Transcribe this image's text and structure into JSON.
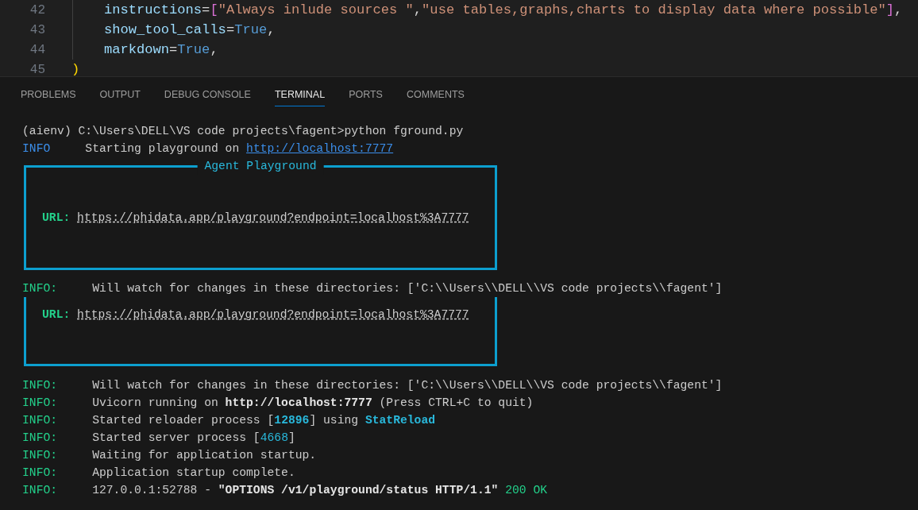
{
  "editor": {
    "lines": [
      {
        "number": "42",
        "kind": "argument",
        "tokens": [
          {
            "text": "instructions",
            "kind": "param"
          },
          {
            "text": "=",
            "kind": "op"
          },
          {
            "text": "[",
            "kind": "bracket"
          },
          {
            "text": "\"Always inlude sources \"",
            "kind": "string"
          },
          {
            "text": ",",
            "kind": "op"
          },
          {
            "text": "\"use tables,graphs,charts to display data where possible\"",
            "kind": "string"
          },
          {
            "text": "]",
            "kind": "bracket"
          },
          {
            "text": ",",
            "kind": "op"
          }
        ]
      },
      {
        "number": "43",
        "kind": "argument",
        "tokens": [
          {
            "text": "show_tool_calls",
            "kind": "param"
          },
          {
            "text": "=",
            "kind": "op"
          },
          {
            "text": "True",
            "kind": "const"
          },
          {
            "text": ",",
            "kind": "op"
          }
        ]
      },
      {
        "number": "44",
        "kind": "argument",
        "tokens": [
          {
            "text": "markdown",
            "kind": "param"
          },
          {
            "text": "=",
            "kind": "op"
          },
          {
            "text": "True",
            "kind": "const"
          },
          {
            "text": ",",
            "kind": "op"
          }
        ]
      },
      {
        "number": "45",
        "kind": "closing",
        "tokens": [
          {
            "text": ")",
            "kind": "paren"
          }
        ]
      }
    ]
  },
  "panel": {
    "tabs": [
      {
        "label": "PROBLEMS",
        "selected": false
      },
      {
        "label": "OUTPUT",
        "selected": false
      },
      {
        "label": "DEBUG CONSOLE",
        "selected": false
      },
      {
        "label": "TERMINAL",
        "selected": true
      },
      {
        "label": "PORTS",
        "selected": false
      },
      {
        "label": "COMMENTS",
        "selected": false
      }
    ]
  },
  "terminal": {
    "lines": [
      {
        "kind": "line",
        "segments": [
          {
            "text": "(aienv) C:\\Users\\DELL\\VS code projects\\fagent>python fground.py",
            "kind": "plain"
          }
        ]
      },
      {
        "kind": "line",
        "prefix": {
          "text": "INFO",
          "kind": "info_blue"
        },
        "segments": [
          {
            "text": "Starting playground on ",
            "kind": "plain"
          },
          {
            "text": "http://localhost:7777",
            "kind": "link"
          }
        ]
      },
      {
        "kind": "box",
        "title": "Agent Playground",
        "url_label": "URL:",
        "url": "https://phidata.app/playground?endpoint=localhost%3A7777"
      },
      {
        "kind": "line",
        "prefix": {
          "text": "INFO:",
          "kind": "info_green"
        },
        "segments": [
          {
            "text": "Will watch for changes in these directories: ['C:\\\\Users\\\\DELL\\\\VS code projects\\\\fagent']",
            "kind": "plain"
          }
        ]
      },
      {
        "kind": "box_open",
        "url_label": "URL:",
        "url": "https://phidata.app/playground?endpoint=localhost%3A7777"
      },
      {
        "kind": "line",
        "prefix": {
          "text": "INFO:",
          "kind": "info_green"
        },
        "segments": [
          {
            "text": "Will watch for changes in these directories: ['C:\\\\Users\\\\DELL\\\\VS code projects\\\\fagent']",
            "kind": "plain"
          }
        ]
      },
      {
        "kind": "line",
        "prefix": {
          "text": "INFO:",
          "kind": "info_green"
        },
        "segments": [
          {
            "text": "Uvicorn running on ",
            "kind": "plain"
          },
          {
            "text": "http://localhost:7777",
            "kind": "bold"
          },
          {
            "text": " (Press CTRL+C to quit)",
            "kind": "plain"
          }
        ]
      },
      {
        "kind": "line",
        "prefix": {
          "text": "INFO:",
          "kind": "info_green"
        },
        "segments": [
          {
            "text": "Started reloader process [",
            "kind": "plain"
          },
          {
            "text": "12896",
            "kind": "number"
          },
          {
            "text": "] using ",
            "kind": "plain"
          },
          {
            "text": "StatReload",
            "kind": "number"
          }
        ]
      },
      {
        "kind": "line",
        "prefix": {
          "text": "INFO:",
          "kind": "info_green"
        },
        "segments": [
          {
            "text": "Started server process [",
            "kind": "plain"
          },
          {
            "text": "4668",
            "kind": "number_light"
          },
          {
            "text": "]",
            "kind": "plain"
          }
        ]
      },
      {
        "kind": "line",
        "prefix": {
          "text": "INFO:",
          "kind": "info_green"
        },
        "segments": [
          {
            "text": "Waiting for application startup.",
            "kind": "plain"
          }
        ]
      },
      {
        "kind": "line",
        "prefix": {
          "text": "INFO:",
          "kind": "info_green"
        },
        "segments": [
          {
            "text": "Application startup complete.",
            "kind": "plain"
          }
        ]
      },
      {
        "kind": "line",
        "prefix": {
          "text": "INFO:",
          "kind": "info_green"
        },
        "segments": [
          {
            "text": "127.0.0.1:52788 - ",
            "kind": "plain"
          },
          {
            "text": "\"OPTIONS /v1/playground/status HTTP/1.1\"",
            "kind": "bold"
          },
          {
            "text": " 200 OK",
            "kind": "ok"
          }
        ]
      }
    ]
  }
}
